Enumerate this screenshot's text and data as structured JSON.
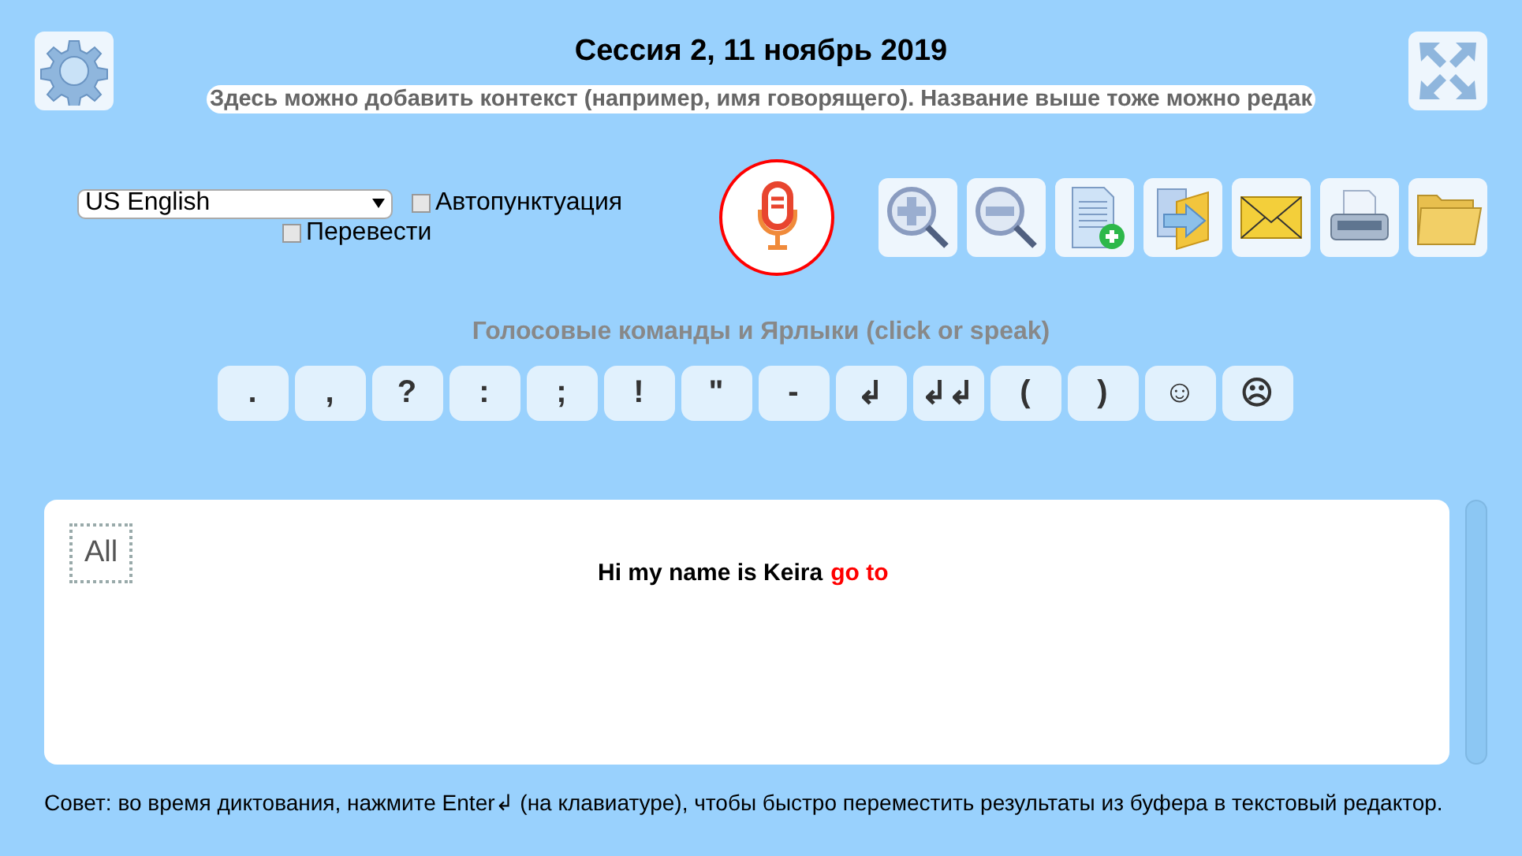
{
  "header": {
    "title": "Сессия 2, 11 ноябрь 2019",
    "context": "Здесь можно добавить контекст (например, имя говорящего). Название выше тоже можно редак"
  },
  "controls": {
    "language": "US English",
    "options": [
      {
        "label": "Автопунктуация",
        "checked": false
      },
      {
        "label": "Перевести",
        "checked": false
      }
    ],
    "recording": false
  },
  "toolbar": [
    {
      "kind": "zoom-in"
    },
    {
      "kind": "zoom-out"
    },
    {
      "kind": "new-document"
    },
    {
      "kind": "export"
    },
    {
      "kind": "mail"
    },
    {
      "kind": "print"
    },
    {
      "kind": "open"
    }
  ],
  "commands": {
    "title": "Голосовые команды и Ярлыки (click or speak)",
    "keys": [
      ".",
      ",",
      "?",
      ":",
      ";",
      "!",
      "\"",
      "-",
      "↲",
      "↲↲",
      "(",
      ")",
      "☺",
      "☹"
    ]
  },
  "editor": {
    "select_all": "All",
    "segments": [
      {
        "text": "Hi my name is Keira",
        "kind": "final"
      },
      {
        "text": "go to",
        "kind": "interim"
      }
    ]
  },
  "tip": "Совет: во время диктования, нажмите Enter↲ (на клавиатуре), чтобы быстро переместить результаты из буфера в текстовый редактор."
}
